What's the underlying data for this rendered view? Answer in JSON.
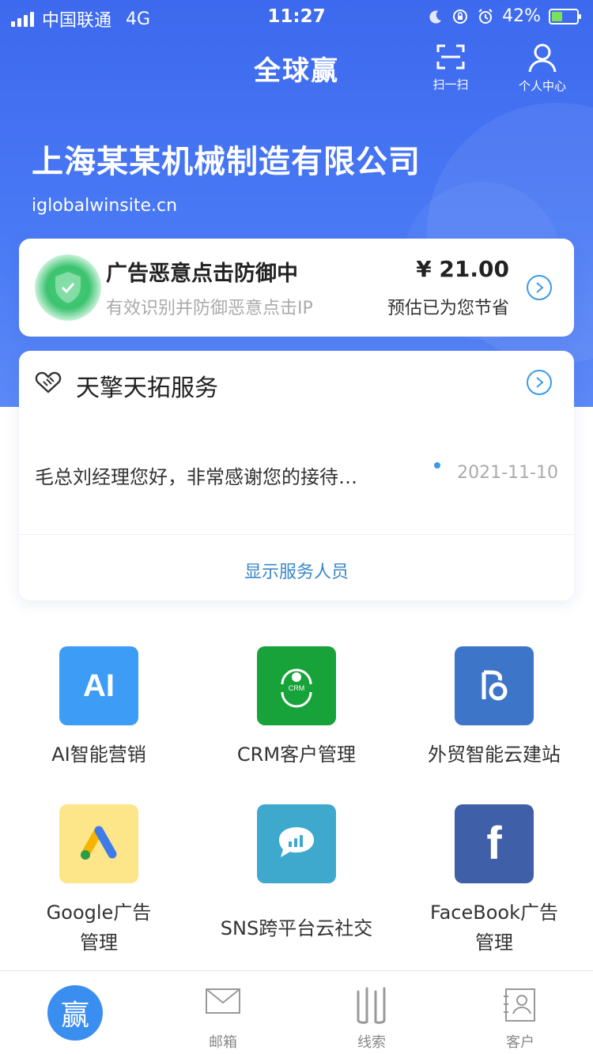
{
  "status_bar": {
    "carrier": "中国联通",
    "network": "4G",
    "time": "11:27",
    "battery": "42%",
    "battery_level": 0.42
  },
  "nav": {
    "title": "全球赢",
    "scan_label": "扫一扫",
    "profile_label": "个人中心"
  },
  "header": {
    "company": "上海某某机械制造有限公司",
    "domain": "iglobalwinsite.cn"
  },
  "ad_defense": {
    "title": "广告恶意点击防御中",
    "subtitle": "有效识别并防御恶意点击IP",
    "amount": "¥ 21.00",
    "amount_caption": "预估已为您节省"
  },
  "service": {
    "title": "天擎天拓服务",
    "message": "毛总刘经理您好，非常感谢您的接待…",
    "date": "2021-11-10",
    "show_staff": "显示服务人员"
  },
  "apps": [
    {
      "name": "AI智能营销",
      "icon": "ai-icon",
      "color": "#3d9cf5"
    },
    {
      "name": "CRM客户管理",
      "icon": "crm-icon",
      "color": "#18a33a"
    },
    {
      "name": "外贸智能云建站",
      "icon": "site-builder-icon",
      "color": "#3d75c9"
    },
    {
      "name": "Google广告\n管理",
      "icon": "google-ads-icon",
      "color": "#fde589"
    },
    {
      "name": "SNS跨平台云社交",
      "icon": "sns-chat-icon",
      "color": "#3ea9cd"
    },
    {
      "name": "FaceBook广告\n管理",
      "icon": "facebook-icon",
      "color": "#3f5fa8"
    }
  ],
  "app_icon_text": {
    "ai": "AI",
    "crm": "CRM",
    "facebook": "f"
  },
  "tabbar": {
    "home_glyph": "赢",
    "mail": "邮箱",
    "leads": "线索",
    "customers": "客户"
  },
  "colors": {
    "primary": "#3d69ee",
    "link": "#3a9be6",
    "shield_green": "#3cc36f"
  }
}
